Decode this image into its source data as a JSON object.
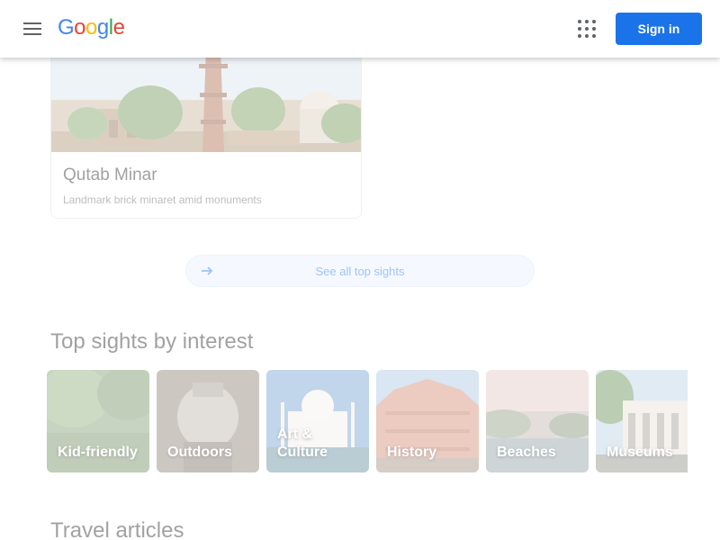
{
  "header": {
    "logo_letters": [
      {
        "char": "G",
        "color": "#4285F4"
      },
      {
        "char": "o",
        "color": "#EA4335"
      },
      {
        "char": "o",
        "color": "#FBBC05"
      },
      {
        "char": "g",
        "color": "#4285F4"
      },
      {
        "char": "l",
        "color": "#34A853"
      },
      {
        "char": "e",
        "color": "#EA4335"
      }
    ],
    "menu_icon": "hamburger-menu-icon",
    "apps_icon": "apps-grid-icon",
    "sign_in_label": "Sign in",
    "accent_color": "#1a73e8"
  },
  "sight": {
    "title": "Qutab Minar",
    "description": "Landmark brick minaret amid monuments"
  },
  "see_all": {
    "label": "See all top sights",
    "icon": "arrow-right-icon"
  },
  "interests": {
    "title": "Top sights by interest",
    "items": [
      {
        "label": "Kid-friendly"
      },
      {
        "label": "Outdoors"
      },
      {
        "label": "Art & Culture"
      },
      {
        "label": "History"
      },
      {
        "label": "Beaches"
      },
      {
        "label": "Museums"
      }
    ]
  },
  "travel": {
    "title": "Travel articles"
  }
}
